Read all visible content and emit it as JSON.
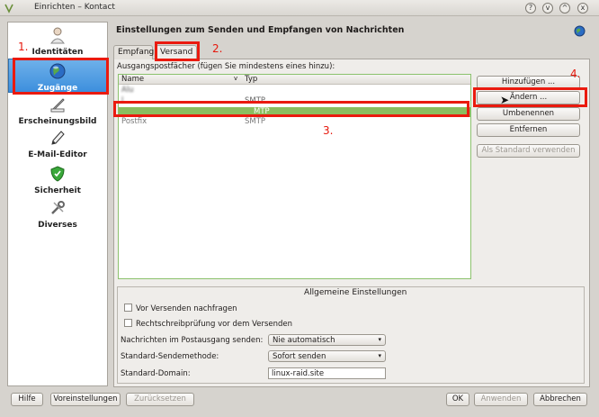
{
  "window": {
    "title": "Einrichten – Kontact",
    "buttons": {
      "help": "?",
      "minimize": "v",
      "maximize": "^",
      "close": "x"
    }
  },
  "sidebar": {
    "items": [
      {
        "label": "Identitäten",
        "icon": "identity-icon",
        "selected": false
      },
      {
        "label": "Zugänge",
        "icon": "globe-icon",
        "selected": true
      },
      {
        "label": "Erscheinungsbild",
        "icon": "appearance-icon",
        "selected": false
      },
      {
        "label": "E-Mail-Editor",
        "icon": "pencil-icon",
        "selected": false
      },
      {
        "label": "Sicherheit",
        "icon": "shield-icon",
        "selected": false
      },
      {
        "label": "Diverses",
        "icon": "tools-icon",
        "selected": false
      }
    ]
  },
  "main": {
    "heading": "Einstellungen zum Senden und Empfangen von Nachrichten",
    "tabs": [
      {
        "label": "Empfang",
        "active": false
      },
      {
        "label": "Versand",
        "active": true
      }
    ],
    "list_label": "Ausgangspostfächer (fügen Sie mindestens eines hinzu):",
    "columns": {
      "name": "Name",
      "type": "Typ"
    },
    "rows": [
      {
        "name": "Alu",
        "type": "",
        "selected": false
      },
      {
        "name": "l",
        "type": "SMTP",
        "selected": false
      },
      {
        "name": "",
        "type": "MTP",
        "selected": true
      },
      {
        "name": "Postfix",
        "type": "SMTP",
        "selected": false
      }
    ],
    "actions": {
      "add": "Hinzufügen ...",
      "change": "Ändern ...",
      "rename": "Umbenennen",
      "remove": "Entfernen",
      "set_default": "Als Standard verwenden"
    },
    "general": {
      "title": "Allgemeine Einstellungen",
      "confirm_before_send": "Vor Versenden nachfragen",
      "spellcheck": "Rechtschreibprüfung vor dem Versenden",
      "send_outbox_label": "Nachrichten im Postausgang senden:",
      "send_outbox_value": "Nie automatisch",
      "send_method_label": "Standard-Sendemethode:",
      "send_method_value": "Sofort senden",
      "domain_label": "Standard-Domain:",
      "domain_value": "linux-raid.site"
    }
  },
  "footer": {
    "help": "Hilfe",
    "defaults": "Voreinstellungen",
    "reset": "Zurücksetzen",
    "ok": "OK",
    "apply": "Anwenden",
    "cancel": "Abbrechen"
  },
  "annotations": {
    "step1": "1.",
    "step2": "2.",
    "step3": "3.",
    "step4": "4."
  },
  "colors": {
    "highlight_red": "#ea1a0f",
    "selection_green": "#8bbd5f",
    "sidebar_selected_blue": "#3d8fdd"
  }
}
